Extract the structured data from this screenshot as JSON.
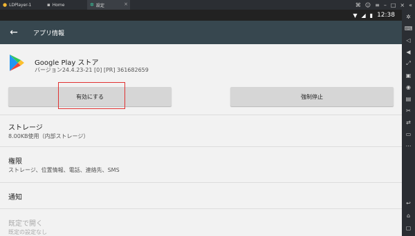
{
  "emulator": {
    "tabs": [
      {
        "label": "LDPlayer-1"
      },
      {
        "label": "Home"
      },
      {
        "label": "設定"
      }
    ]
  },
  "statusbar": {
    "time": "12:38"
  },
  "appbar": {
    "title": "アプリ情報"
  },
  "app": {
    "name": "Google Play ストア",
    "version": "バージョン24.4.23-21 [0] [PR] 361682659"
  },
  "buttons": {
    "enable": "有効にする",
    "force_stop": "強制停止"
  },
  "rows": [
    {
      "title": "ストレージ",
      "subtitle": "8.00KB使用（内部ストレージ）"
    },
    {
      "title": "権限",
      "subtitle": "ストレージ、位置情報、電話、連絡先、SMS"
    },
    {
      "title": "通知",
      "subtitle": ""
    },
    {
      "title": "既定で開く",
      "subtitle": "既定の設定なし"
    }
  ],
  "colors": {
    "appbar": "#37474f",
    "content_bg": "#f2f2f2",
    "button_bg": "#d6d6d6",
    "highlight": "#e03030"
  }
}
